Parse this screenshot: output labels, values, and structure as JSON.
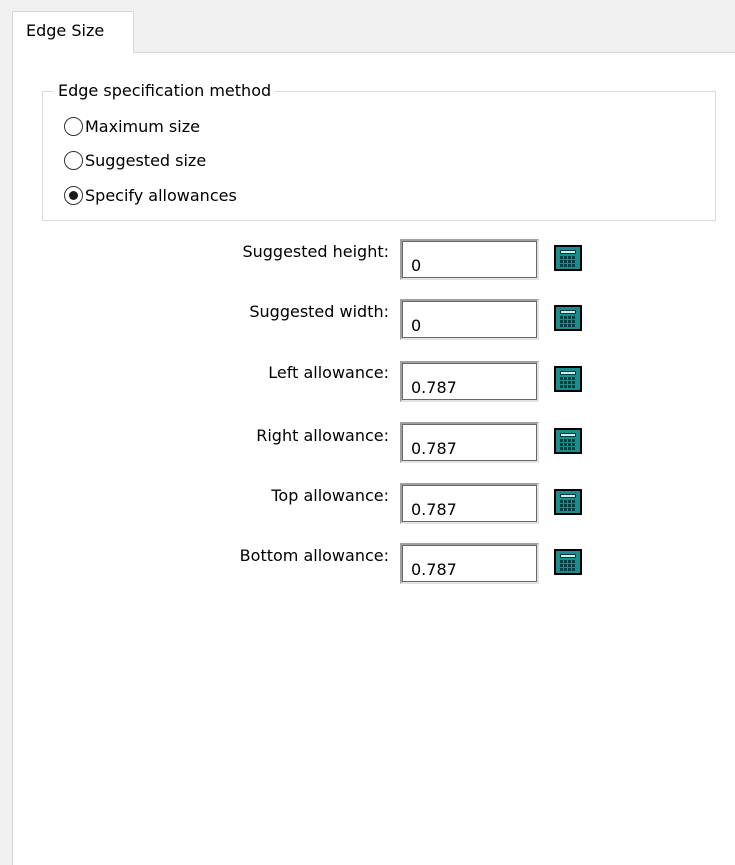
{
  "tabs": [
    {
      "label": "Edge Size",
      "active": true
    }
  ],
  "group": {
    "legend": "Edge specification method",
    "options": [
      {
        "label": "Maximum size",
        "checked": false
      },
      {
        "label": "Suggested size",
        "checked": false
      },
      {
        "label": "Specify allowances",
        "checked": true
      }
    ]
  },
  "fields": [
    {
      "label": "Suggested height:",
      "value": "0"
    },
    {
      "label": "Suggested width:",
      "value": "0"
    },
    {
      "label": "Left allowance:",
      "value": "0.787"
    },
    {
      "label": "Right allowance:",
      "value": "0.787"
    },
    {
      "label": "Top allowance:",
      "value": "0.787"
    },
    {
      "label": "Bottom allowance:",
      "value": "0.787"
    }
  ],
  "icons": {
    "calculator": "calculator-icon"
  },
  "colors": {
    "panel_bg": "#ffffff",
    "window_bg": "#f0f0f0",
    "calculator": "#1d8c8c"
  }
}
